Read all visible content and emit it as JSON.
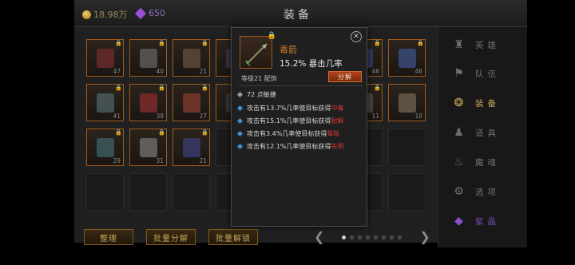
{
  "header": {
    "gold": "18.98万",
    "gems": "650",
    "title": "装备",
    "close_icon": "diamond-close-icon"
  },
  "inventory": {
    "slots": [
      {
        "level": "47",
        "locked": true,
        "item": true
      },
      {
        "level": "40",
        "locked": true,
        "item": true
      },
      {
        "level": "21",
        "locked": true,
        "item": true
      },
      {
        "level": "",
        "locked": false,
        "item": true
      },
      {
        "level": "",
        "locked": false,
        "item": true
      },
      {
        "level": "",
        "locked": false,
        "item": true
      },
      {
        "level": "46",
        "locked": true,
        "item": true
      },
      {
        "level": "46",
        "locked": true,
        "item": true
      },
      {
        "level": "41",
        "locked": true,
        "item": true
      },
      {
        "level": "39",
        "locked": true,
        "item": true
      },
      {
        "level": "27",
        "locked": true,
        "item": true
      },
      {
        "level": "",
        "locked": false,
        "item": true
      },
      {
        "level": "",
        "locked": false,
        "item": true
      },
      {
        "level": "",
        "locked": false,
        "item": true
      },
      {
        "level": "11",
        "locked": true,
        "item": true
      },
      {
        "level": "10",
        "locked": false,
        "item": true
      },
      {
        "level": "29",
        "locked": true,
        "item": true
      },
      {
        "level": "31",
        "locked": true,
        "item": true
      },
      {
        "level": "21",
        "locked": true,
        "item": true
      }
    ]
  },
  "bottom": {
    "sort_label": "整理",
    "bulk_disassemble_label": "批量分解",
    "bulk_unlock_label": "批量解锁",
    "page_count": 8,
    "current_page": 1
  },
  "sidebar": {
    "items": [
      {
        "label": "英雄",
        "icon": "helmet-icon",
        "active": false
      },
      {
        "label": "队伍",
        "icon": "flag-icon",
        "active": false
      },
      {
        "label": "装备",
        "icon": "equipment-icon",
        "active": true
      },
      {
        "label": "道具",
        "icon": "bag-icon",
        "active": false
      },
      {
        "label": "魔魂",
        "icon": "flame-icon",
        "active": false
      },
      {
        "label": "选项",
        "icon": "gear-icon",
        "active": false
      },
      {
        "label": "紫晶",
        "icon": "crystal-icon",
        "active": false
      }
    ]
  },
  "tooltip": {
    "name": "毒箭",
    "main_stat": "15.2% 暴击几率",
    "requirement": "等级21 配饰",
    "action_label": "分解",
    "base_stat": "72 点敏捷",
    "effects": [
      {
        "text": "攻击有13.7%几率使目标获得",
        "status": "中毒"
      },
      {
        "text": "攻击有15.1%几率使目标获得",
        "status": "耐解"
      },
      {
        "text": "攻击有3.4%几率使目标获得",
        "status": "晕眩"
      },
      {
        "text": "攻击有12.1%几率使目标获得",
        "status": "失明"
      }
    ],
    "colors": {
      "name": "#d07a2a",
      "status": "#d43434",
      "button": "#b1441b"
    }
  }
}
